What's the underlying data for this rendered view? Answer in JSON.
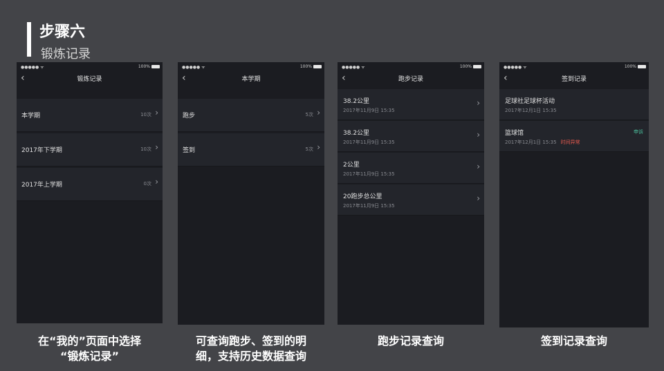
{
  "header": {
    "title": "步骤六",
    "subtitle": "锻炼记录"
  },
  "phones": [
    {
      "status": {
        "signal": "●●●●● ᯤ",
        "battery": "100%"
      },
      "nav_title": "锻炼记录",
      "rows": [
        {
          "label": "本学期",
          "count": "10次"
        },
        {
          "label": "2017年下学期",
          "count": "10次"
        },
        {
          "label": "2017年上学期",
          "count": "0次"
        }
      ]
    },
    {
      "status": {
        "signal": "●●●●● ᯤ",
        "battery": "100%"
      },
      "nav_title": "本学期",
      "rows": [
        {
          "label": "跑步",
          "count": "5次"
        },
        {
          "label": "签到",
          "count": "5次"
        }
      ]
    },
    {
      "status": {
        "signal": "●●●●● ᯤ",
        "battery": "100%"
      },
      "nav_title": "跑步记录",
      "rows": [
        {
          "label": "38.2公里",
          "time": "2017年11月9日  15:35"
        },
        {
          "label": "38.2公里",
          "time": "2017年11月9日  15:35"
        },
        {
          "label": "2公里",
          "time": "2017年11月9日  15:35"
        },
        {
          "label": "20跑步总公里",
          "time": "2017年11月9日  15:35"
        }
      ]
    },
    {
      "status": {
        "signal": "●●●●● ᯤ",
        "battery": "100%"
      },
      "nav_title": "签到记录",
      "rows": [
        {
          "label": "足球社足球杯活动",
          "time": "2017年12月1日  15:35"
        },
        {
          "label": "篮球馆",
          "time": "2017年12月1日  15:35",
          "warning": "时间异常",
          "action": "申诉"
        }
      ]
    }
  ],
  "captions": [
    {
      "line1": "在“我的”页面中选择",
      "line2": "“锻炼记录”"
    },
    {
      "line1": "可查询跑步、签到的明",
      "line2": "细，支持历史数据查询"
    },
    {
      "line1": "跑步记录查询",
      "line2": ""
    },
    {
      "line1": "签到记录查询",
      "line2": ""
    }
  ],
  "icons": {
    "back": "chevron-left-icon",
    "row": "chevron-right-icon"
  }
}
